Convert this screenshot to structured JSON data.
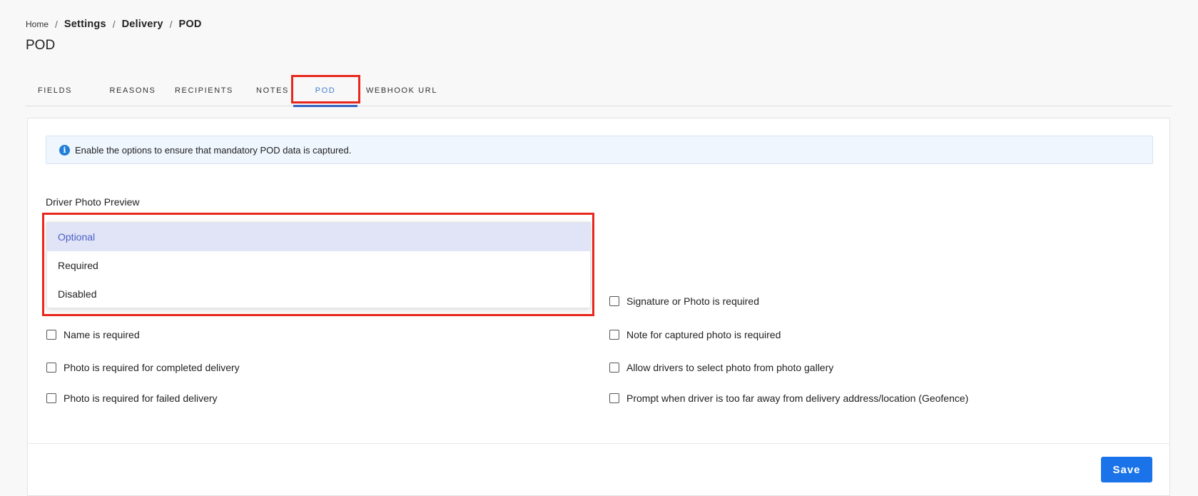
{
  "breadcrumb": {
    "home": "Home",
    "separator": "/",
    "settings": "Settings",
    "delivery": "Delivery",
    "current": "POD"
  },
  "page_title": "POD",
  "tabs": [
    {
      "label": "FIELDS",
      "active": false
    },
    {
      "label": "REASONS",
      "active": false
    },
    {
      "label": "RECIPIENTS",
      "active": false
    },
    {
      "label": "NOTES",
      "active": false
    },
    {
      "label": "POD",
      "active": true
    },
    {
      "label": "WEBHOOK URL",
      "active": false
    }
  ],
  "info_banner": {
    "icon": "info-icon",
    "icon_glyph": "i",
    "text": "Enable the options to ensure that mandatory POD data is captured."
  },
  "driver_photo_preview": {
    "label": "Driver Photo Preview",
    "options": [
      "Optional",
      "Required",
      "Disabled"
    ],
    "selected": "Optional"
  },
  "checkboxes": {
    "signature_or_photo": "Signature or Photo is required",
    "name_required": "Name is required",
    "note_for_photo": "Note for captured photo is required",
    "photo_completed": "Photo is required for completed delivery",
    "allow_gallery": "Allow drivers to select photo from photo gallery",
    "photo_failed": "Photo is required for failed delivery",
    "geofence": "Prompt when driver is too far away from delivery address/location (Geofence)"
  },
  "save_label": "Save",
  "colors": {
    "accent": "#1a73e8",
    "tab_active": "#3f7fd0",
    "highlight": "#e8281c",
    "selected_option_bg": "#e1e4f6"
  }
}
